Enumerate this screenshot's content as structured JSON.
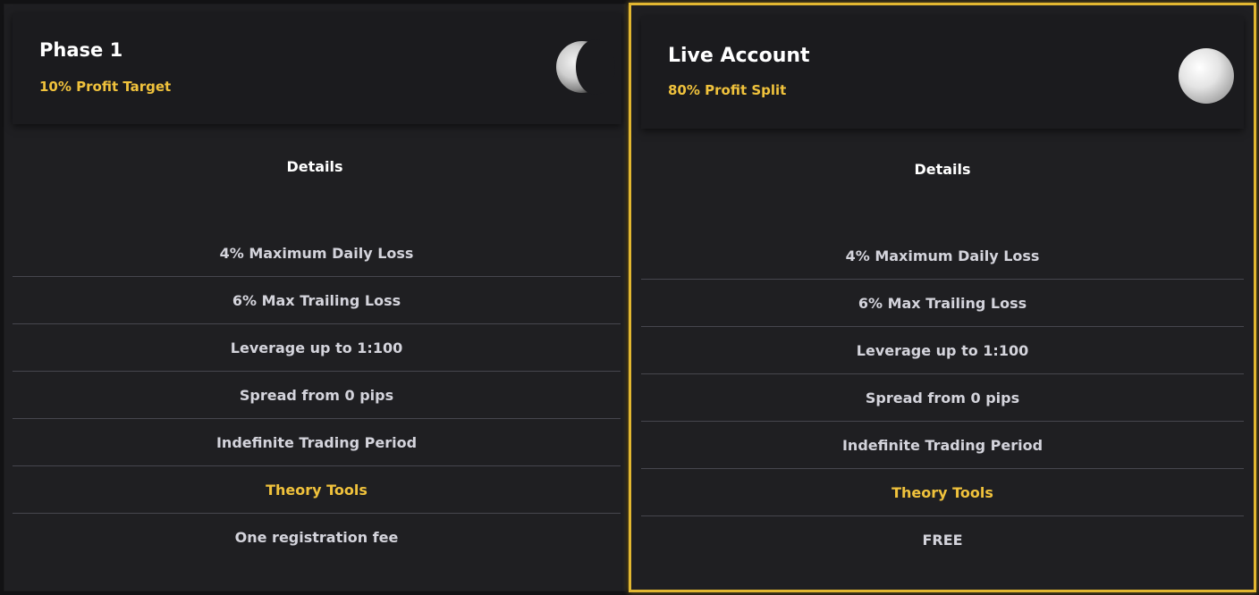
{
  "plans": [
    {
      "title": "Phase 1",
      "subtitle": "10% Profit Target",
      "details_title": "Details",
      "features": [
        "4% Maximum Daily Loss",
        "6% Max Trailing Loss",
        "Leverage up to 1:100",
        "Spread from 0 pips",
        "Indefinite Trading Period",
        "Theory Tools",
        "One registration fee"
      ],
      "icon": "half-moon-icon"
    },
    {
      "title": "Live Account",
      "subtitle": "80% Profit Split",
      "details_title": "Details",
      "features": [
        "4% Maximum Daily Loss",
        "6% Max Trailing Loss",
        "Leverage up to 1:100",
        "Spread from 0 pips",
        "Indefinite Trading Period",
        "Theory Tools",
        "FREE"
      ],
      "icon": "full-moon-icon"
    }
  ],
  "colors": {
    "accent": "#f0c23c",
    "highlight_border": "#e2b731",
    "card_bg": "#1f1f22",
    "text": "#d4d4dc"
  }
}
